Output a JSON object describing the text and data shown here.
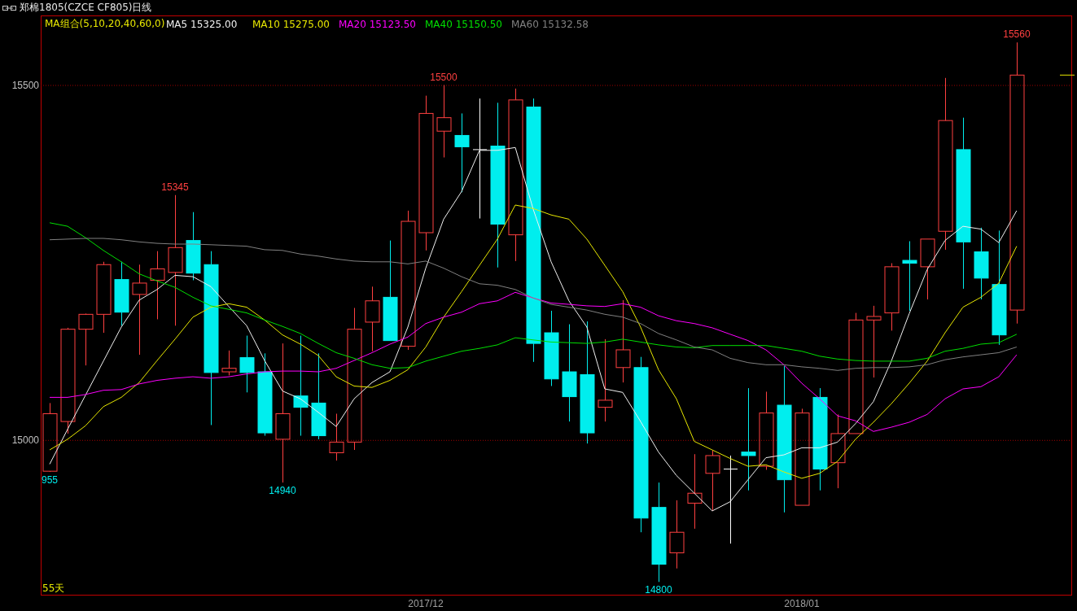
{
  "window": {
    "title": "郑棉1805(CZCE CF805)日线"
  },
  "legend": {
    "title": "MA组合(5,10,20,40,60,0)",
    "readings": [
      "15325.00",
      "15275.00",
      "15123.50",
      "15150.50",
      "15132.58"
    ]
  },
  "period_label": "55天",
  "price_labels": [
    "955",
    "15345",
    "14940",
    "15500",
    "14800",
    "15560"
  ],
  "chart_data": {
    "type": "line",
    "categories": [
      null,
      null,
      null,
      null,
      null,
      null,
      null,
      null,
      null,
      null,
      null,
      null,
      null,
      null,
      null,
      null,
      null,
      null,
      null,
      null,
      null,
      "2017/12",
      null,
      null,
      null,
      null,
      null,
      null,
      null,
      null,
      null,
      null,
      null,
      null,
      null,
      null,
      null,
      null,
      null,
      null,
      null,
      null,
      "2018/01",
      null,
      null,
      null,
      null,
      null,
      null,
      null,
      null,
      null,
      null,
      null,
      null
    ],
    "ylim": [
      14782,
      15598
    ],
    "yticks": [
      15000,
      15500
    ],
    "series": [
      {
        "name": "MA5",
        "color": "#f0f0f0",
        "values": [
          14966,
          15015,
          15063,
          15111,
          15159,
          15197,
          15212,
          15232,
          15230,
          15216,
          15188,
          15161,
          15112,
          15069,
          15058,
          15039,
          15019,
          15058,
          15081,
          15096,
          15159,
          15242,
          15311,
          15350,
          15408,
          15408,
          15412,
          15325,
          15251,
          15196,
          15159,
          15072,
          15067,
          15026,
          14983,
          14950,
          14925,
          14900,
          14913,
          14944,
          14975,
          14979,
          14989,
          14989,
          14997,
          15023,
          15054,
          15111,
          15178,
          15240,
          15281,
          15301,
          15297,
          15278,
          15323
        ]
      },
      {
        "name": "MA10",
        "color": "#e8e800",
        "values": [
          14986,
          15001,
          15020,
          15047,
          15060,
          15081,
          15112,
          15142,
          15173,
          15187,
          15192,
          15187,
          15169,
          15148,
          15135,
          15119,
          15089,
          15076,
          15074,
          15084,
          15099,
          15131,
          15173,
          15209,
          15246,
          15283,
          15331,
          15326,
          15317,
          15311,
          15283,
          15246,
          15209,
          15159,
          15099,
          15058,
          14998,
          14986,
          14974,
          14963,
          14965,
          14955,
          14946,
          14953,
          14970,
          15001,
          15025,
          15051,
          15080,
          15111,
          15151,
          15187,
          15201,
          15221,
          15273
        ]
      },
      {
        "name": "MA20",
        "color": "#ff00ff",
        "values": [
          15060,
          15060,
          15064,
          15070,
          15071,
          15079,
          15084,
          15087,
          15089,
          15087,
          15089,
          15093,
          15096,
          15097,
          15097,
          15096,
          15101,
          15112,
          15123,
          15135,
          15145,
          15164,
          15173,
          15180,
          15192,
          15196,
          15208,
          15200,
          15193,
          15191,
          15189,
          15188,
          15192,
          15187,
          15175,
          15168,
          15164,
          15158,
          15149,
          15140,
          15127,
          15106,
          15080,
          15058,
          15034,
          15027,
          15012,
          15018,
          15025,
          15036,
          15058,
          15072,
          15075,
          15089,
          15120
        ]
      },
      {
        "name": "MA40",
        "color": "#00e000",
        "values": [
          15306,
          15301,
          15285,
          15267,
          15251,
          15234,
          15224,
          15215,
          15201,
          15189,
          15184,
          15179,
          15169,
          15160,
          15150,
          15136,
          15123,
          15115,
          15106,
          15101,
          15102,
          15111,
          15118,
          15125,
          15129,
          15134,
          15144,
          15141,
          15138,
          15137,
          15136,
          15138,
          15142,
          15138,
          15134,
          15131,
          15130,
          15133,
          15133,
          15133,
          15133,
          15129,
          15125,
          15118,
          15114,
          15112,
          15111,
          15111,
          15111,
          15115,
          15125,
          15129,
          15135,
          15137,
          15149
        ]
      },
      {
        "name": "MA60",
        "color": "#808080",
        "values": [
          15282,
          15283,
          15284,
          15284,
          15282,
          15279,
          15277,
          15276,
          15276,
          15275,
          15274,
          15273,
          15268,
          15267,
          15262,
          15259,
          15255,
          15252,
          15251,
          15251,
          15248,
          15252,
          15242,
          15230,
          15220,
          15218,
          15212,
          15200,
          15191,
          15187,
          15183,
          15177,
          15173,
          15164,
          15150,
          15141,
          15131,
          15127,
          15115,
          15109,
          15106,
          15106,
          15103,
          15101,
          15098,
          15101,
          15102,
          15102,
          15103,
          15106,
          15113,
          15117,
          15120,
          15123,
          15131
        ]
      }
    ]
  }
}
